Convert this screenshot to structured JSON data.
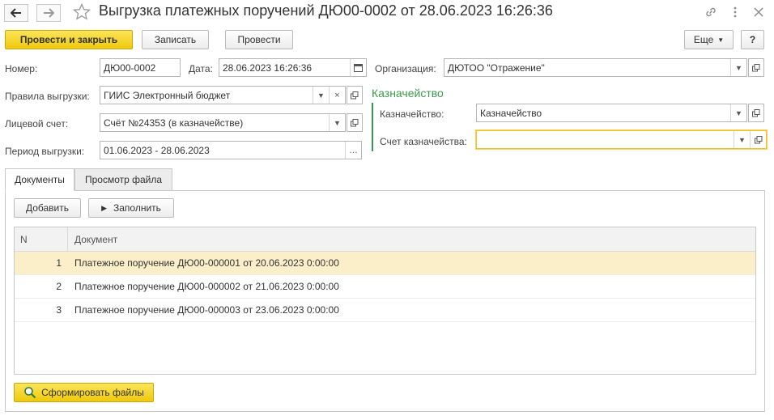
{
  "window": {
    "title": "Выгрузка платежных поручений ДЮ00-0002 от 28.06.2023 16:26:36"
  },
  "toolbar": {
    "post_close_label": "Провести и закрыть",
    "save_label": "Записать",
    "post_label": "Провести",
    "more_label": "Еще",
    "help_label": "?"
  },
  "form": {
    "number": {
      "label": "Номер:",
      "value": "ДЮ00-0002"
    },
    "date": {
      "label": "Дата:",
      "value": "28.06.2023 16:26:36"
    },
    "organization": {
      "label": "Организация:",
      "value": "ДЮТОО \"Отражение\""
    },
    "rules": {
      "label": "Правила выгрузки:",
      "value": "ГИИС Электронный бюджет"
    },
    "account": {
      "label": "Лицевой счет:",
      "value": "Счёт №24353 (в казначействе)"
    },
    "period": {
      "label": "Период выгрузки:",
      "value": "01.06.2023 - 28.06.2023"
    }
  },
  "treasury_group": {
    "title": "Казначейство",
    "treasury": {
      "label": "Казначейство:",
      "value": "Казначейство"
    },
    "treasury_account": {
      "label": "Счет казначейства:",
      "value": ""
    }
  },
  "tabs": [
    {
      "label": "Документы",
      "active": true
    },
    {
      "label": "Просмотр файла",
      "active": false
    }
  ],
  "documents": {
    "add_label": "Добавить",
    "fill_label": "Заполнить",
    "columns": {
      "n": "N",
      "doc": "Документ"
    },
    "rows": [
      {
        "n": "1",
        "doc": "Платежное поручение ДЮ00-000001 от 20.06.2023 0:00:00",
        "selected": true
      },
      {
        "n": "2",
        "doc": "Платежное поручение ДЮ00-000002 от 21.06.2023 0:00:00",
        "selected": false
      },
      {
        "n": "3",
        "doc": "Платежное поручение ДЮ00-000003 от 23.06.2023 0:00:00",
        "selected": false
      }
    ],
    "generate_label": "Сформировать файлы"
  },
  "colors": {
    "accent_yellow": "#f0c90c",
    "group_green": "#3b9a4a",
    "selected_row": "#fbefc9"
  }
}
